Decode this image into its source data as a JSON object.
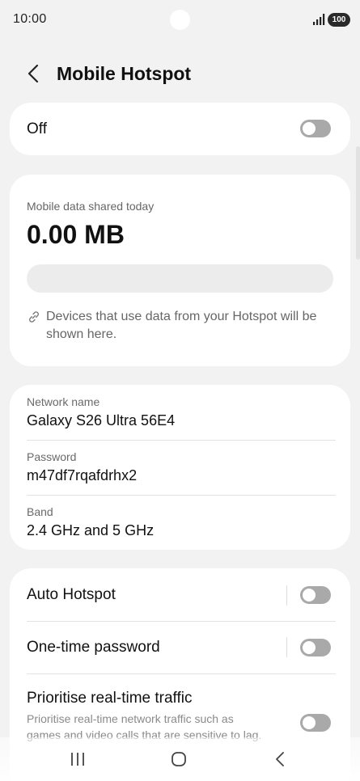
{
  "status_bar": {
    "time": "10:00",
    "battery": "100",
    "icons": [
      "signal-icon",
      "battery-icon"
    ]
  },
  "header": {
    "title": "Mobile Hotspot",
    "back_icon": "chevron-left-icon"
  },
  "hotspot_switch": {
    "label": "Off",
    "enabled": false
  },
  "usage": {
    "label": "Mobile data shared today",
    "value": "0.00 MB",
    "progress_fraction": 0,
    "note": "Devices that use data from your Hotspot will be shown here.",
    "note_icon": "link-icon"
  },
  "network": {
    "items": [
      {
        "caption": "Network name",
        "value": "Galaxy S26 Ultra 56E4"
      },
      {
        "caption": "Password",
        "value": "m47df7rqafdrhx2"
      },
      {
        "caption": "Band",
        "value": "2.4 GHz and 5 GHz"
      }
    ]
  },
  "options": {
    "items": [
      {
        "label": "Auto Hotspot",
        "enabled": false
      },
      {
        "label": "One-time password",
        "enabled": false
      },
      {
        "label": "Prioritise real-time traffic",
        "description": "Prioritise real-time network traffic such as games and video calls that are sensitive to lag.",
        "enabled": false
      }
    ]
  },
  "nav_bar": {
    "icons": [
      "recent-apps-icon",
      "home-icon",
      "back-icon"
    ]
  },
  "colors": {
    "background": "#f2f2f2",
    "card": "#ffffff",
    "toggle_off": "#a9a9a9"
  }
}
